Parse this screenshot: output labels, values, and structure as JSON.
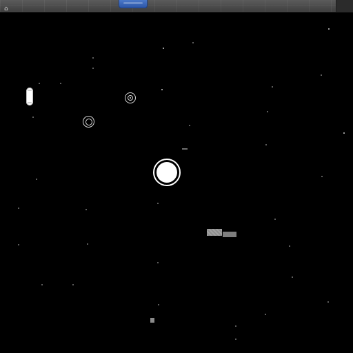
{
  "ui": {
    "top_left_glyph": "⌂"
  },
  "colors": {
    "background": "#000000",
    "top_bar": "#4a4a4a",
    "top_center_plate": "#2d56a8",
    "orb": "#ffffff",
    "rings": "#d8d8d8",
    "pill": "#ffffff",
    "debris": "#8e8e8e"
  },
  "icons": {
    "top_left_glyph": "home-glyph-icon",
    "player": "player-orb-icon",
    "ring_target_1": "ring-target-icon",
    "ring_target_2": "ring-target-icon",
    "pickup": "pill-pickup-icon",
    "debris": "debris-icon",
    "small_block": "small-block-icon"
  }
}
